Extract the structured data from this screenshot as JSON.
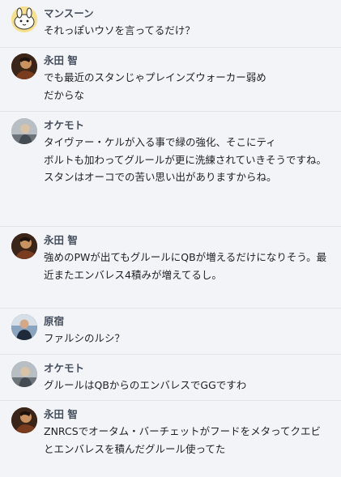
{
  "messages": [
    {
      "name": "マンスーン",
      "text": "それっぽいウソを言ってるだけ？"
    },
    {
      "name": "永田 智",
      "text": "でも最近のスタンじゃプレインズウォーカー弱め\nだからな"
    },
    {
      "name": "オケモト",
      "text": "タイヴァー・ケルが入る事で緑の強化、そこにティ\nボルトも加わってグルールが更に洗練されていきそうですね。\nスタンはオーコでの苦い思い出がありますからね。"
    },
    {
      "name": "永田 智",
      "text": "強めのPWが出てもグルールにQBが増えるだけになりそう。最近またエンバレス4積みが増えてるし。"
    },
    {
      "name": "原宿",
      "text": "ファルシのルシ？"
    },
    {
      "name": "オケモト",
      "text": "グルールはQBからのエンバレスでGGですわ"
    },
    {
      "name": "永田 智",
      "text": "ZNRCSでオータム・バーチェットがフードをメタってクエビとエンバレスを積んだグルール使ってた"
    }
  ]
}
